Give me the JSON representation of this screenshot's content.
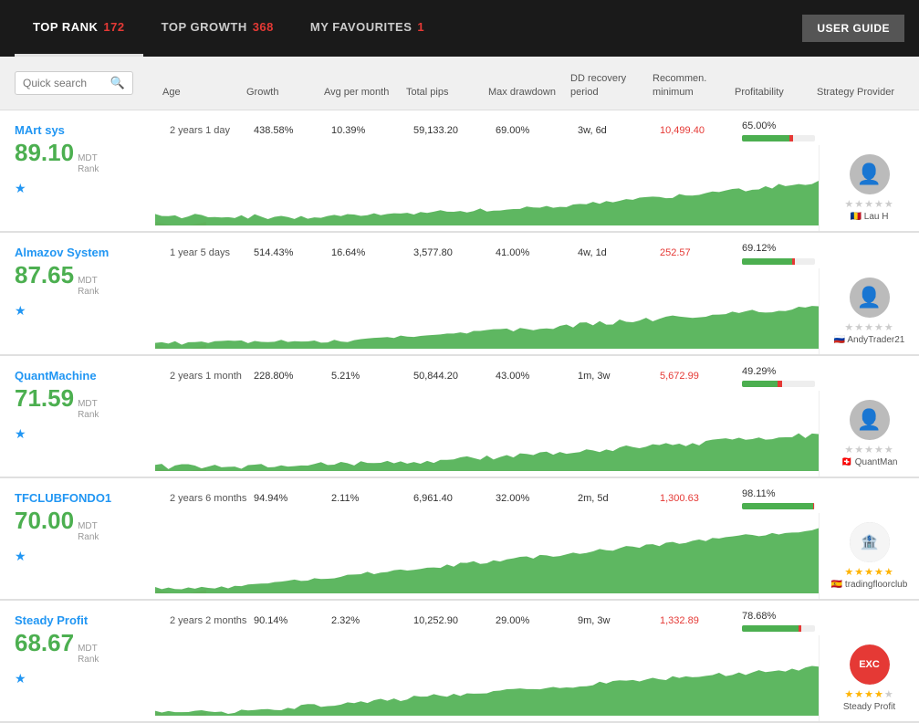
{
  "header": {
    "nav": [
      {
        "label": "TOP RANK",
        "count": "172",
        "active": true
      },
      {
        "label": "TOP GROWTH",
        "count": "368",
        "active": false
      },
      {
        "label": "MY FAVOURITES",
        "count": "1",
        "active": false
      }
    ],
    "user_guide": "USER GUIDE"
  },
  "search": {
    "placeholder": "Quick search"
  },
  "columns": [
    {
      "key": "age",
      "label": "Age"
    },
    {
      "key": "growth",
      "label": "Growth"
    },
    {
      "key": "avg",
      "label": "Avg per month"
    },
    {
      "key": "pips",
      "label": "Total pips"
    },
    {
      "key": "dd",
      "label": "Max drawdown"
    },
    {
      "key": "ddrec",
      "label": "DD recovery period"
    },
    {
      "key": "recom",
      "label": "Recommen. minimum"
    },
    {
      "key": "profit",
      "label": "Profitability"
    },
    {
      "key": "provider",
      "label": "Strategy Provider"
    }
  ],
  "strategies": [
    {
      "name": "MArt sys",
      "rank": "89.10",
      "rank_label": "MDT\nRank",
      "age": "2 years 1 day",
      "growth": "438.58%",
      "avg": "10.39%",
      "pips": "59,133.20",
      "dd": "69.00%",
      "dd_rec": "3w, 6d",
      "recom": "10,499.40",
      "profit_val": "65.00%",
      "profit_pct": 65,
      "profit_neg": 5,
      "provider_name": "Lau H",
      "provider_stars": 0,
      "provider_icon": "person",
      "provider_flag": "🇷🇴",
      "chart_color": "#4CAF50",
      "chart_type": "mart"
    },
    {
      "name": "Almazov System",
      "rank": "87.65",
      "rank_label": "MDT\nRank",
      "age": "1 year 5 days",
      "growth": "514.43%",
      "avg": "16.64%",
      "pips": "3,577.80",
      "dd": "41.00%",
      "dd_rec": "4w, 1d",
      "recom": "252.57",
      "profit_val": "69.12%",
      "profit_pct": 69,
      "profit_neg": 3,
      "provider_name": "AndyTrader21",
      "provider_stars": 0,
      "provider_icon": "trader",
      "provider_flag": "🇷🇺",
      "chart_color": "#4CAF50",
      "chart_type": "almazov"
    },
    {
      "name": "QuantMachine",
      "rank": "71.59",
      "rank_label": "MDT\nRank",
      "age": "2 years 1 month",
      "growth": "228.80%",
      "avg": "5.21%",
      "pips": "50,844.20",
      "dd": "43.00%",
      "dd_rec": "1m, 3w",
      "recom": "5,672.99",
      "profit_val": "49.29%",
      "profit_pct": 49,
      "profit_neg": 6,
      "provider_name": "QuantMan",
      "provider_stars": 0,
      "provider_icon": "person",
      "provider_flag": "🇨🇭",
      "chart_color": "#4CAF50",
      "chart_type": "quant"
    },
    {
      "name": "TFCLUBFONDO1",
      "rank": "70.00",
      "rank_label": "MDT\nRank",
      "age": "2 years 6 months",
      "growth": "94.94%",
      "avg": "2.11%",
      "pips": "6,961.40",
      "dd": "32.00%",
      "dd_rec": "2m, 5d",
      "recom": "1,300.63",
      "profit_val": "98.11%",
      "profit_pct": 98,
      "profit_neg": 1,
      "provider_name": "tradingfloorclub",
      "provider_stars": 5,
      "provider_icon": "trading",
      "provider_flag": "🇪🇸",
      "chart_color": "#4CAF50",
      "chart_type": "tfc"
    },
    {
      "name": "Steady Profit",
      "rank": "68.67",
      "rank_label": "MDT\nRank",
      "age": "2 years 2 months",
      "growth": "90.14%",
      "avg": "2.32%",
      "pips": "10,252.90",
      "dd": "29.00%",
      "dd_rec": "9m, 3w",
      "recom": "1,332.89",
      "profit_val": "78.68%",
      "profit_pct": 78,
      "profit_neg": 3,
      "provider_name": "Steady Profit",
      "provider_stars": 4,
      "provider_icon": "exc",
      "provider_flag": "",
      "chart_color": "#4CAF50",
      "chart_type": "steady"
    }
  ]
}
